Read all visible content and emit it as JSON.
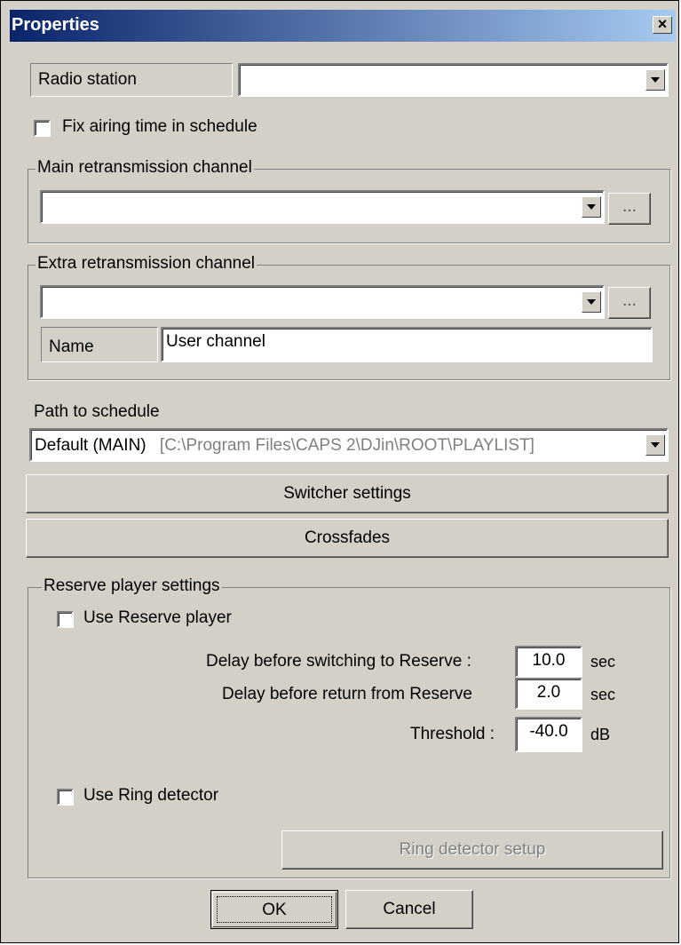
{
  "window": {
    "title": "Properties",
    "close_glyph": "×"
  },
  "radio_station": {
    "label": "Radio station",
    "value": ""
  },
  "fix_airing": {
    "label": "Fix airing time in schedule",
    "checked": false
  },
  "main_channel": {
    "group_title": "Main retransmission channel",
    "value": "",
    "browse_label": "..."
  },
  "extra_channel": {
    "group_title": "Extra retransmission channel",
    "value": "",
    "browse_label": "...",
    "name_label": "Name",
    "name_value": "User channel"
  },
  "path": {
    "label": "Path to schedule",
    "selected_main": "Default (MAIN)",
    "selected_path": "[C:\\Program Files\\CAPS 2\\DJin\\ROOT\\PLAYLIST]"
  },
  "buttons": {
    "switcher": "Switcher settings",
    "crossfades": "Crossfades",
    "ring_setup": "Ring detector setup",
    "ok": "OK",
    "cancel": "Cancel"
  },
  "reserve": {
    "group_title": "Reserve player settings",
    "use_reserve_label": "Use Reserve player",
    "use_reserve_checked": false,
    "delay_switch_label": "Delay before switching to Reserve :",
    "delay_switch_value": "10.0",
    "delay_switch_unit": "sec",
    "delay_return_label": "Delay before return from Reserve",
    "delay_return_value": "2.0",
    "delay_return_unit": "sec",
    "threshold_label": "Threshold :",
    "threshold_value": "-40.0",
    "threshold_unit": "dB",
    "ring_label": "Use Ring detector",
    "ring_checked": false
  },
  "colors": {
    "face": "#d4d0c8",
    "title_start": "#0a246a",
    "title_end": "#a6caf0",
    "disabled_text": "#808080"
  }
}
